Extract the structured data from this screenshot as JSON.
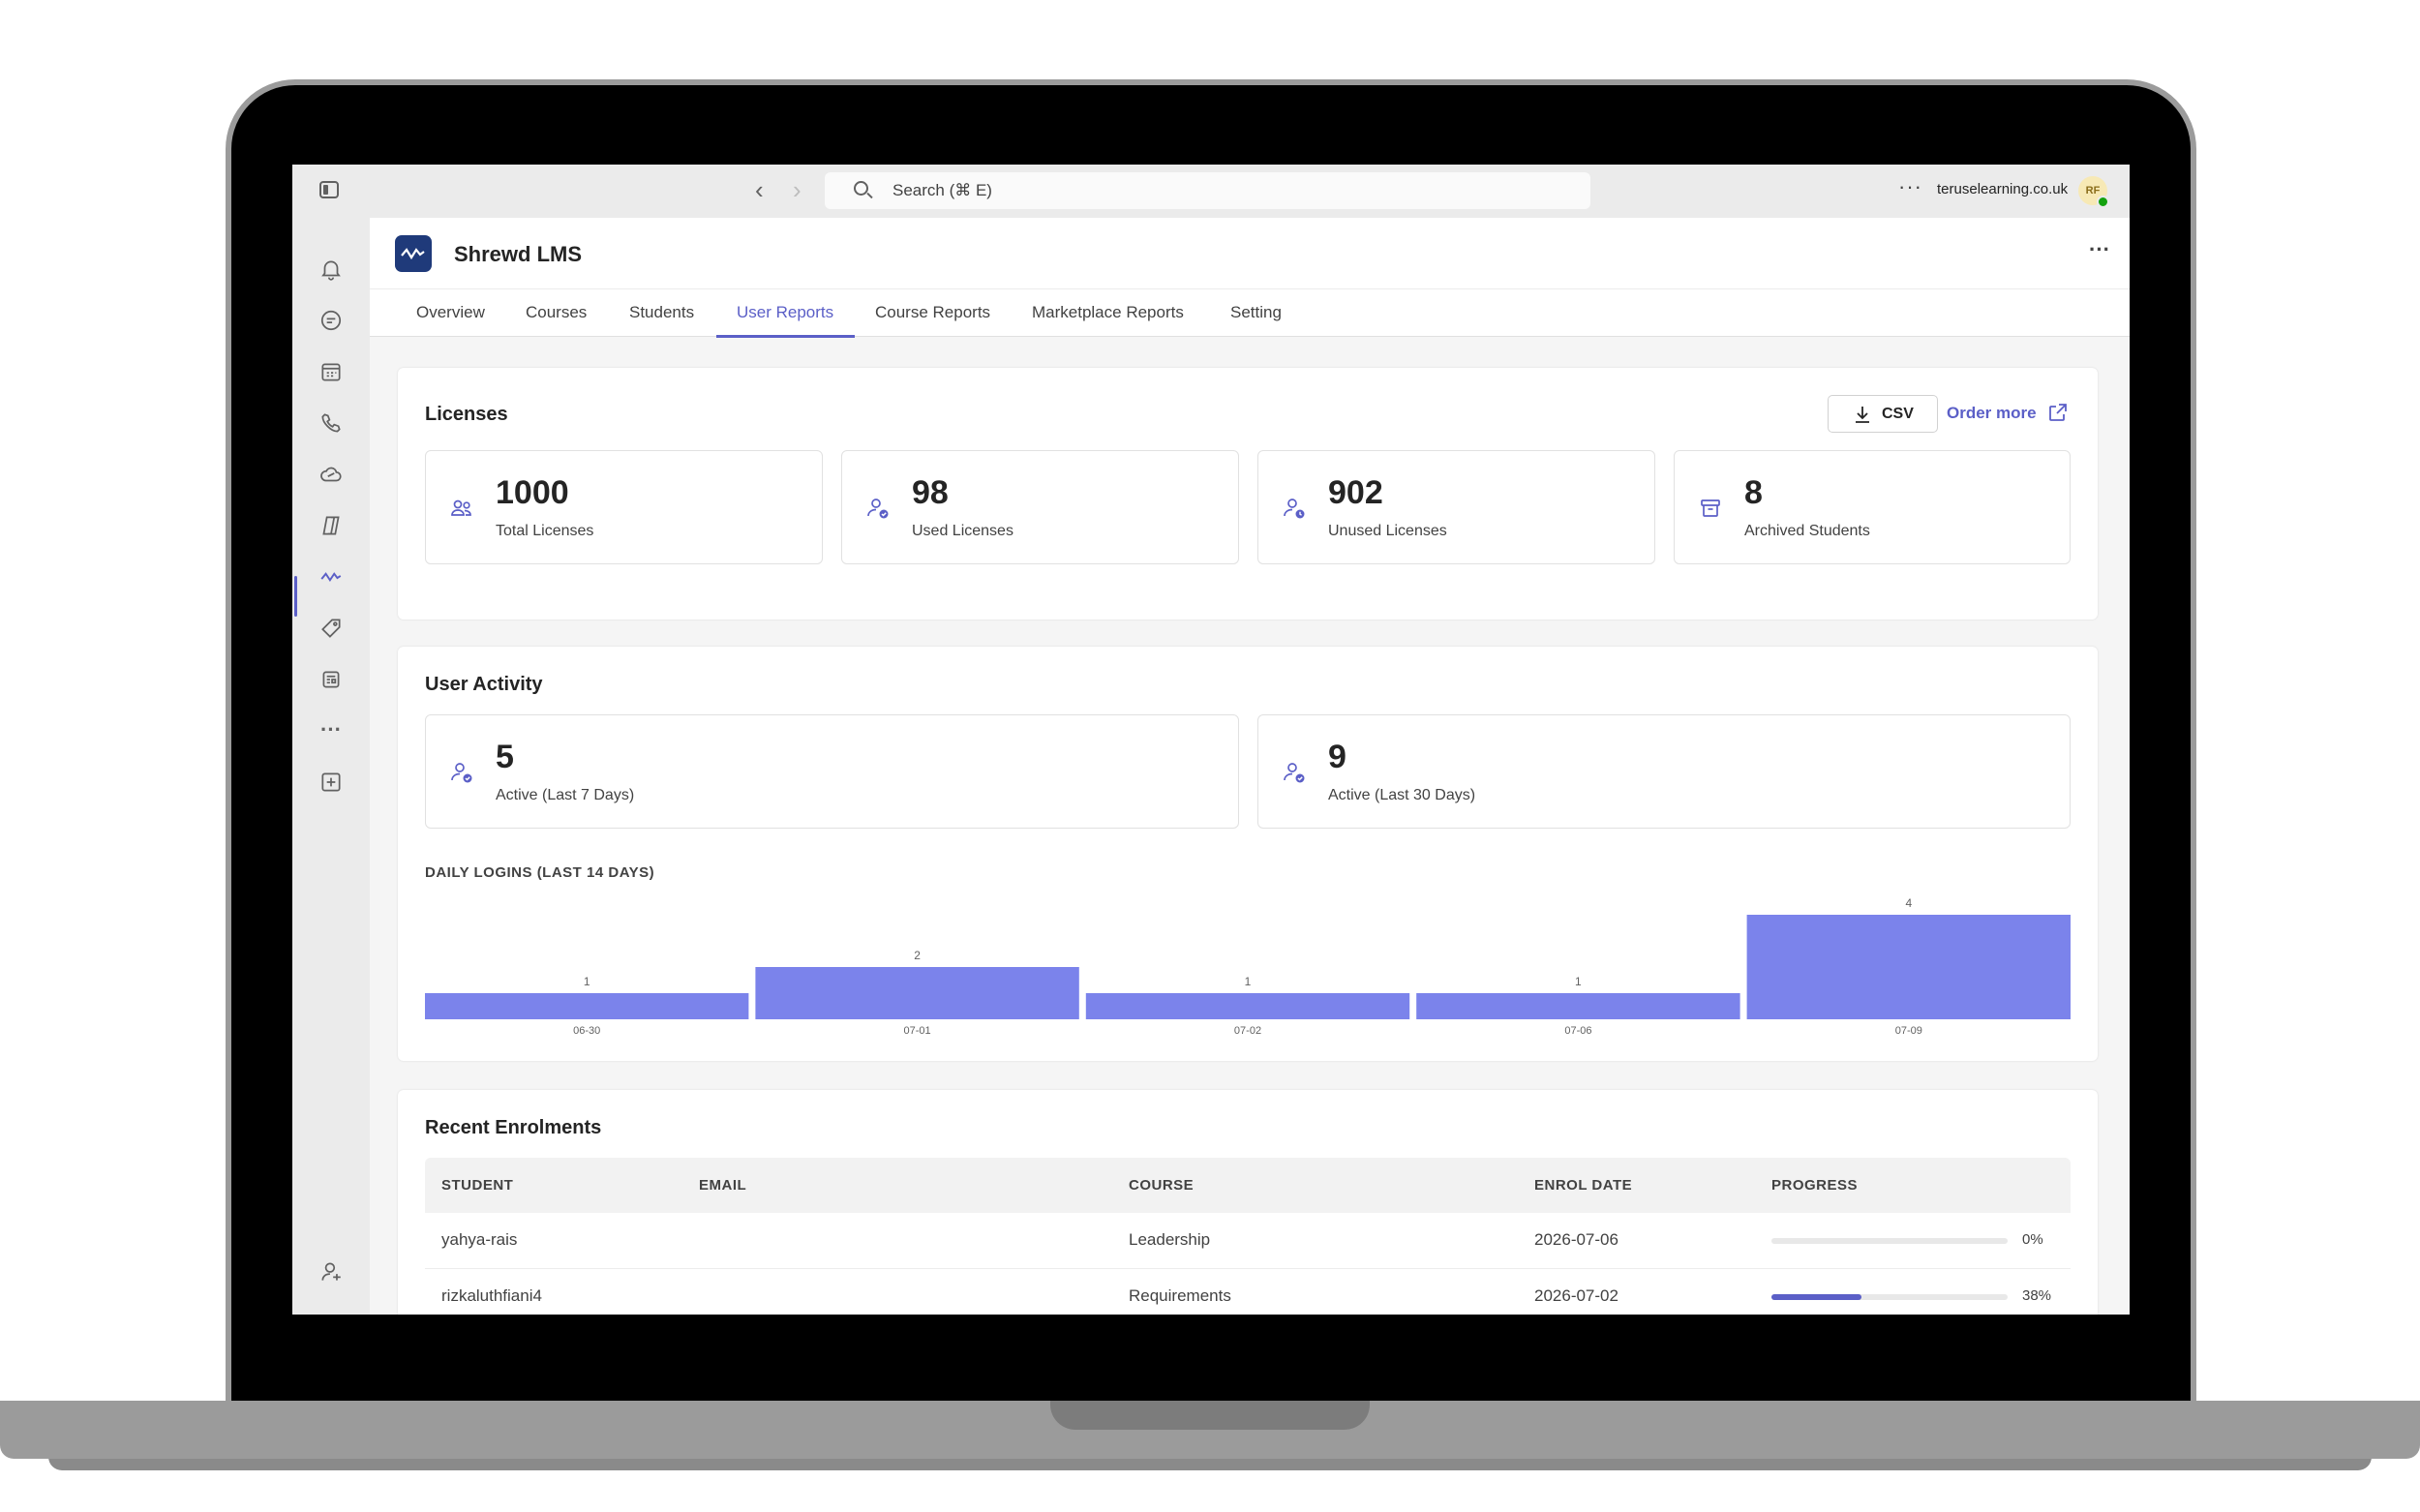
{
  "window": {
    "search_placeholder": "Search (⌘ E)",
    "tenant": "teruselearning.co.uk",
    "avatar_initials": "RF"
  },
  "rail": {
    "icons": [
      "bell-icon",
      "chat-icon",
      "calendar-icon",
      "phone-icon",
      "cloud-icon",
      "copilot-icon",
      "app-activity-icon",
      "tag-icon",
      "news-icon",
      "more-apps-icon",
      "add-app-icon",
      "help-icon"
    ]
  },
  "app": {
    "title": "Shrewd LMS",
    "more_label": "···",
    "tabs": [
      {
        "label": "Overview"
      },
      {
        "label": "Courses"
      },
      {
        "label": "Students"
      },
      {
        "label": "User Reports"
      },
      {
        "label": "Course Reports"
      },
      {
        "label": "Marketplace Reports"
      },
      {
        "label": "Setting"
      }
    ],
    "active_tab": "User Reports"
  },
  "licenses": {
    "title": "Licenses",
    "csv_label": "CSV",
    "order_more_label": "Order more",
    "stats": [
      {
        "value": "1000",
        "label": "Total Licenses",
        "icon": "users-icon"
      },
      {
        "value": "98",
        "label": "Used Licenses",
        "icon": "user-check-icon"
      },
      {
        "value": "902",
        "label": "Unused Licenses",
        "icon": "user-clock-icon"
      },
      {
        "value": "8",
        "label": "Archived Students",
        "icon": "archive-icon"
      }
    ]
  },
  "activity": {
    "title": "User Activity",
    "stats": [
      {
        "value": "5",
        "label": "Active (Last 7 Days)",
        "icon": "user-check-icon"
      },
      {
        "value": "9",
        "label": "Active (Last 30 Days)",
        "icon": "user-check-icon"
      }
    ],
    "chart_title": "DAILY LOGINS (LAST 14 DAYS)"
  },
  "chart_data": {
    "type": "bar",
    "title": "DAILY LOGINS (LAST 14 DAYS)",
    "categories": [
      "06-30",
      "07-01",
      "07-02",
      "07-06",
      "07-09"
    ],
    "values": [
      1,
      2,
      1,
      1,
      4
    ],
    "xlabel": "",
    "ylabel": "",
    "ylim": [
      0,
      4
    ],
    "grid": false,
    "bar_color": "#7b83eb"
  },
  "enrolments": {
    "title": "Recent Enrolments",
    "columns": [
      "STUDENT",
      "EMAIL",
      "COURSE",
      "ENROL DATE",
      "PROGRESS"
    ],
    "rows": [
      {
        "student": "yahya-rais",
        "email": "",
        "course": "Leadership",
        "date": "2026-07-06",
        "progress": 0,
        "progress_label": "0%"
      },
      {
        "student": "rizkaluthfiani4",
        "email": "",
        "course": "Requirements",
        "date": "2026-07-02",
        "progress": 38,
        "progress_label": "38%"
      }
    ]
  },
  "colors": {
    "accent": "#5b5fc7",
    "bar": "#7b83eb",
    "app_logo": "#1f3a7a"
  }
}
